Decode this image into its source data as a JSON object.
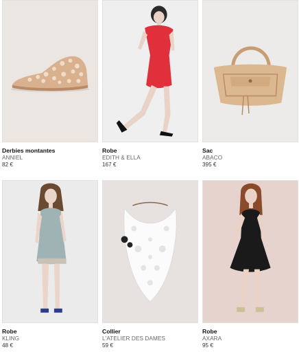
{
  "products": [
    {
      "category": "Derbies montantes",
      "brand": "ANNIEL",
      "price": "82 €",
      "image_icon": "lace-ankle-boot-image",
      "bg": "#ece6e3"
    },
    {
      "category": "Robe",
      "brand": "EDITH & ELLA",
      "price": "167 €",
      "image_icon": "red-dress-model-image",
      "bg": "#efefef"
    },
    {
      "category": "Sac",
      "brand": "ABACO",
      "price": "395 €",
      "image_icon": "beige-handbag-image",
      "bg": "#ecebe9"
    },
    {
      "category": "Robe",
      "brand": "KLING",
      "price": "48 €",
      "image_icon": "grey-blue-dress-model-image",
      "bg": "#ebebeb"
    },
    {
      "category": "Collier",
      "brand": "L'ATELIER DES DAMES",
      "price": "59 €",
      "image_icon": "white-lace-collar-necklace-image",
      "bg": "#e7e2e0"
    },
    {
      "category": "Robe",
      "brand": "AXARA",
      "price": "95 €",
      "image_icon": "black-dress-model-image",
      "bg": "#e7d3cd"
    }
  ],
  "colors": {
    "accent_red": "#e0303c",
    "bag_tan": "#d9b48c",
    "dress_blue": "#9fb3b5",
    "dress_black": "#1a1a1a"
  }
}
